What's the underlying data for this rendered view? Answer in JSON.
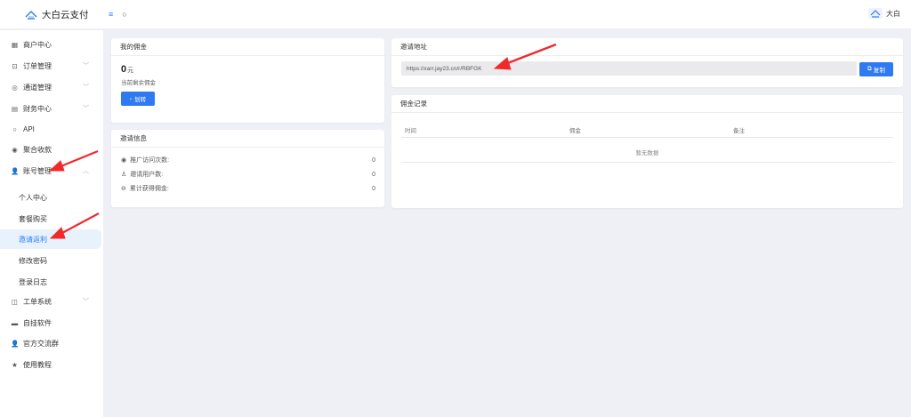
{
  "brand": {
    "title": "大白云支付"
  },
  "header": {
    "menu_icon": "≡",
    "search_icon": "○",
    "username": "大白"
  },
  "sidebar": {
    "items": [
      {
        "label": "商户中心",
        "icon": "grid-icon"
      },
      {
        "label": "订单管理",
        "icon": "order-icon"
      },
      {
        "label": "通道管理",
        "icon": "channel-icon"
      },
      {
        "label": "财务中心",
        "icon": "finance-icon"
      },
      {
        "label": "API",
        "icon": "api-icon"
      },
      {
        "label": "聚合收款",
        "icon": "collect-icon"
      },
      {
        "label": "账号管理",
        "icon": "user-icon"
      }
    ],
    "sub_items": [
      {
        "label": "个人中心"
      },
      {
        "label": "套餐购买"
      },
      {
        "label": "邀请返利"
      },
      {
        "label": "修改密码"
      },
      {
        "label": "登录日志"
      }
    ],
    "items_bottom": [
      {
        "label": "工单系统",
        "icon": "ticket-icon"
      },
      {
        "label": "自挂软件",
        "icon": "software-icon"
      },
      {
        "label": "官方交流群",
        "icon": "group-icon"
      },
      {
        "label": "使用教程",
        "icon": "star-icon"
      }
    ]
  },
  "commission": {
    "title": "我的佣金",
    "amount": "0",
    "unit": "元",
    "desc": "当前剩余佣金",
    "transfer_btn": "划转"
  },
  "invite_info": {
    "title": "邀请信息",
    "rows": [
      {
        "label": "推广访问次数:",
        "value": "0"
      },
      {
        "label": "邀请用户数:",
        "value": "0"
      },
      {
        "label": "累计获得佣金:",
        "value": "0"
      }
    ]
  },
  "invite_url": {
    "title": "邀请地址",
    "url": "https://xarr.jay23.cn/r/RBFGK",
    "copy_btn": "复制"
  },
  "records": {
    "title": "佣金记录",
    "columns": [
      "时间",
      "佣金",
      "备注"
    ],
    "empty": "暂无数据"
  },
  "colors": {
    "accent": "#2f7af2",
    "annotation": "#f02a2a",
    "active_bg": "#e8f2fd"
  }
}
